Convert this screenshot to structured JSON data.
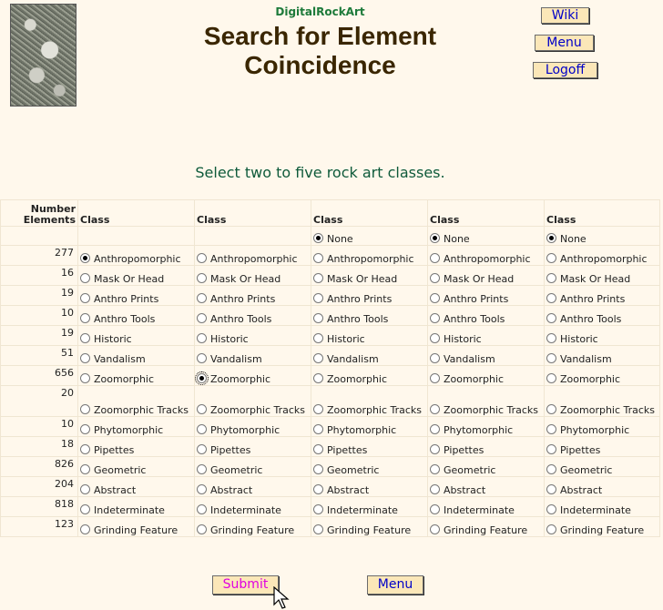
{
  "header": {
    "brand": "DigitalRockArt",
    "title_line1": "Search for Element",
    "title_line2": "Coincidence",
    "wiki": "Wiki",
    "menu": "Menu",
    "logoff": "Logoff"
  },
  "instructions": "Select two to five rock art classes.",
  "table": {
    "number_header_line1": "Number",
    "number_header_line2": "Elements",
    "class_header": "Class",
    "none_label": "None",
    "rows": [
      {
        "count": "277",
        "label": "Anthropomorphic",
        "tall": false
      },
      {
        "count": "16",
        "label": "Mask Or Head",
        "tall": false
      },
      {
        "count": "19",
        "label": "Anthro Prints",
        "tall": false
      },
      {
        "count": "10",
        "label": "Anthro Tools",
        "tall": false
      },
      {
        "count": "19",
        "label": "Historic",
        "tall": false
      },
      {
        "count": "51",
        "label": "Vandalism",
        "tall": false
      },
      {
        "count": "656",
        "label": "Zoomorphic",
        "tall": false
      },
      {
        "count": "20",
        "label": "Zoomorphic Tracks",
        "tall": true
      },
      {
        "count": "10",
        "label": "Phytomorphic",
        "tall": false
      },
      {
        "count": "18",
        "label": "Pipettes",
        "tall": false
      },
      {
        "count": "826",
        "label": "Geometric",
        "tall": false
      },
      {
        "count": "204",
        "label": "Abstract",
        "tall": false
      },
      {
        "count": "818",
        "label": "Indeterminate",
        "tall": false
      },
      {
        "count": "123",
        "label": "Grinding Feature",
        "tall": false
      }
    ],
    "selected": [
      "Anthropomorphic",
      "Zoomorphic",
      "None",
      "None",
      "None"
    ]
  },
  "footer": {
    "submit": "Submit",
    "menu": "Menu"
  },
  "colors": {
    "background": "#fff8ec",
    "button_bg": "#fbe7b8",
    "button_text": "#0000c8",
    "submit_text": "#e000e0",
    "title_text": "#3a2600",
    "brand_text": "#1d7a3a",
    "instruction_text": "#0e5a3a"
  }
}
